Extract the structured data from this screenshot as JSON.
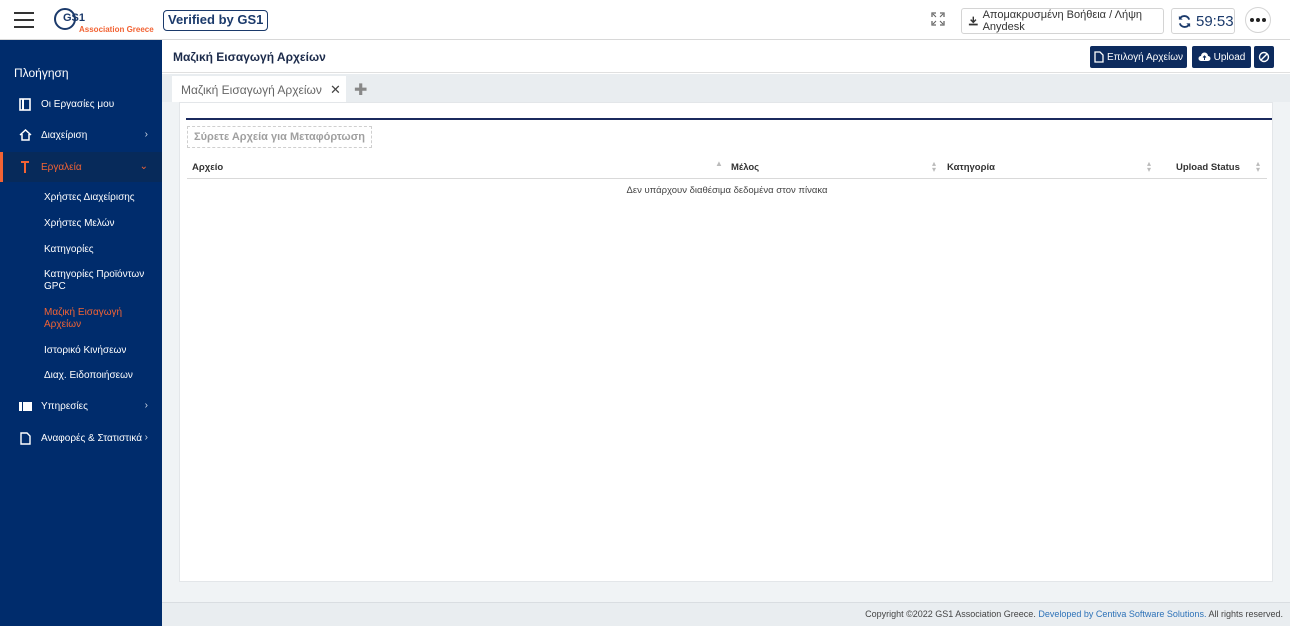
{
  "topbar": {
    "logo_main": "GS1",
    "logo_sub": "Association Greece",
    "verified": "Verified by GS1",
    "remote_label": "Απομακρυσμένη Βοήθεια / Λήψη Anydesk",
    "timer": "59:53"
  },
  "sidebar": {
    "title": "Πλοήγηση",
    "items": [
      {
        "label": "Οι Εργασίες μου"
      },
      {
        "label": "Διαχείριση"
      },
      {
        "label": "Εργαλεία"
      },
      {
        "label": "Υπηρεσίες"
      },
      {
        "label": "Αναφορές & Στατιστικά"
      }
    ],
    "subitems": [
      {
        "label": "Χρήστες Διαχείρισης"
      },
      {
        "label": "Χρήστες Μελών"
      },
      {
        "label": "Κατηγορίες"
      },
      {
        "label": "Κατηγορίες Προϊόντων GPC"
      },
      {
        "label": "Μαζική Εισαγωγή Αρχείων"
      },
      {
        "label": "Ιστορικό Κινήσεων"
      },
      {
        "label": "Διαχ. Ειδοποιήσεων"
      }
    ]
  },
  "page": {
    "title": "Μαζική Εισαγωγή Αρχείων",
    "select_files": "Επιλογή Αρχείων",
    "upload": "Upload"
  },
  "tabs": [
    {
      "label": "Μαζική Εισαγωγή Αρχείων"
    }
  ],
  "content": {
    "dropzone": "Σύρετε Αρχεία για Μεταφόρτωση",
    "columns": [
      "Αρχείο",
      "Μέλος",
      "Κατηγορία",
      "Upload Status"
    ],
    "empty_message": "Δεν υπάρχουν διαθέσιμα δεδομένα στον πίνακα"
  },
  "footer": {
    "copyright": "Copyright ©2022 GS1 Association Greece.",
    "developed": "Developed by Centiva Software Solutions.",
    "rights": "All rights reserved."
  },
  "colors": {
    "sidebar_bg": "#002c6c",
    "accent": "#f26334",
    "button_bg": "#0d2b5e"
  }
}
